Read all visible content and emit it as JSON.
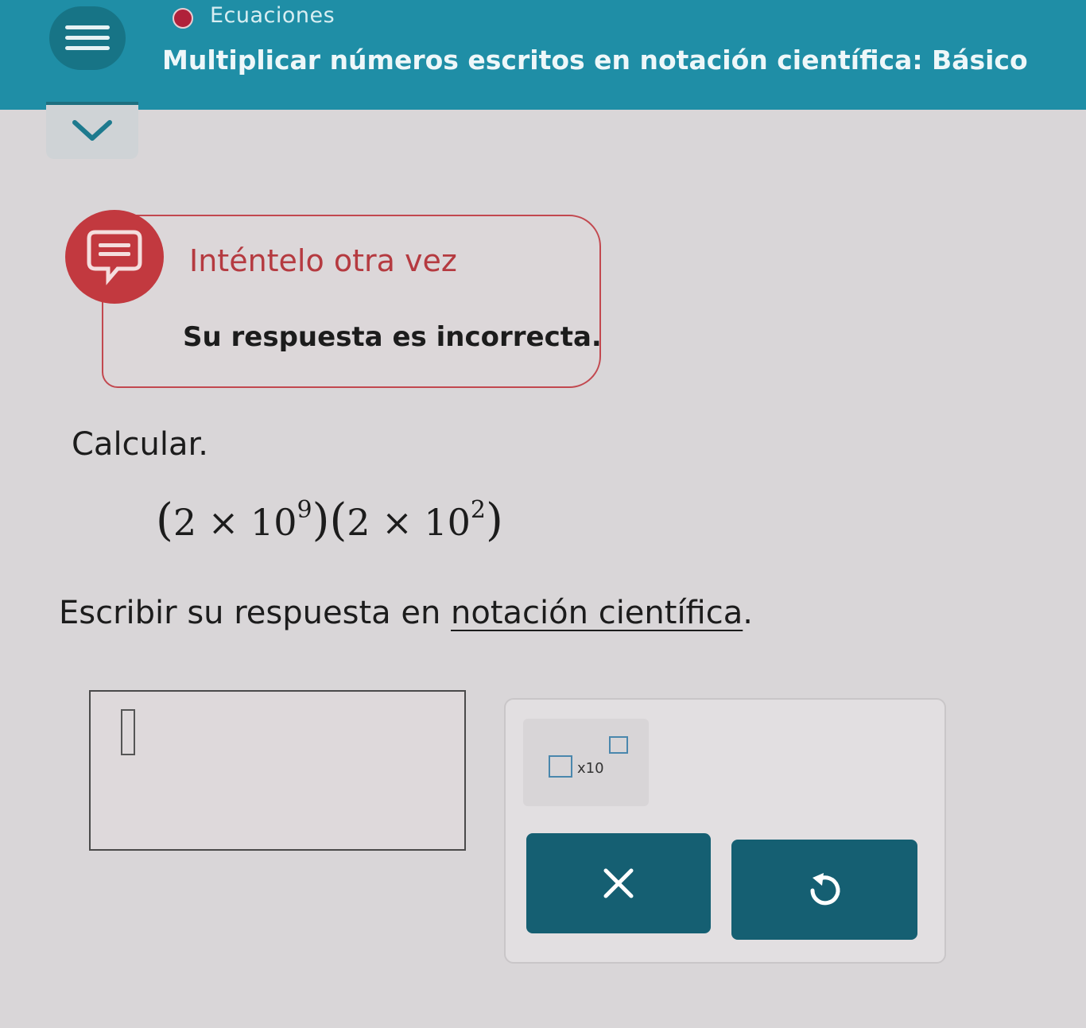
{
  "header": {
    "topic": "Ecuaciones",
    "title": "Multiplicar números escritos en notación científica: Básico"
  },
  "feedback": {
    "title": "Inténtelo otra vez",
    "message": "Su respuesta es incorrecta."
  },
  "problem": {
    "instruction": "Calcular.",
    "expression": {
      "open": "(",
      "coef1": "2",
      "times": "×",
      "base1": "10",
      "exp1": "9",
      "close": ")",
      "coef2": "2",
      "base2": "10",
      "exp2": "2"
    },
    "prompt_before": "Escribir su respuesta en ",
    "prompt_link": "notación científica",
    "prompt_after": "."
  },
  "answer": {
    "value": ""
  },
  "keypad": {
    "sci_key_label": "x10",
    "clear_icon": "close-icon",
    "undo_icon": "undo-icon"
  },
  "colors": {
    "header": "#1f8ea6",
    "error": "#c2393f",
    "button": "#155f72"
  }
}
